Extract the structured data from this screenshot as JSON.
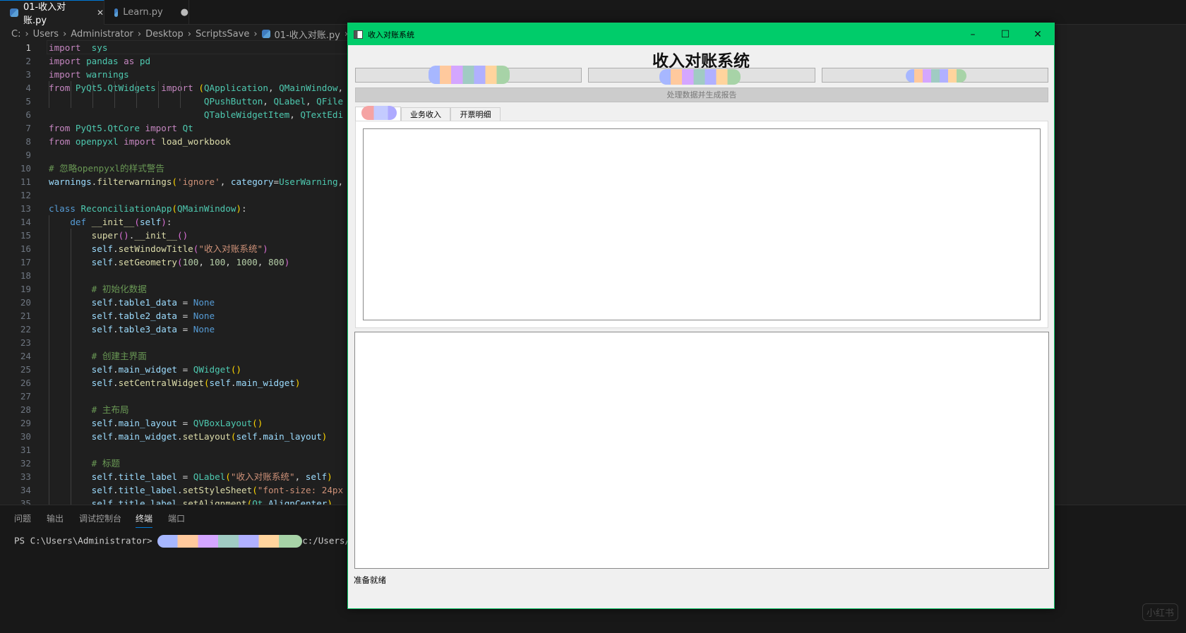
{
  "editor": {
    "tabs": [
      {
        "label": "01-收入对账.py",
        "close": "✕"
      },
      {
        "label": "Learn.py",
        "dirty": "●"
      }
    ],
    "breadcrumb": [
      "C:",
      "Users",
      "Administrator",
      "Desktop",
      "ScriptsSave",
      "01-收入对账.py",
      "..."
    ],
    "current_line": 1,
    "lines": [
      [
        [
          "kw",
          "import"
        ],
        [
          "",
          "  "
        ],
        [
          "mod",
          "sys"
        ]
      ],
      [
        [
          "kw",
          "import"
        ],
        [
          "mod",
          " pandas"
        ],
        [
          "kw",
          " as"
        ],
        [
          "mod",
          " pd"
        ]
      ],
      [
        [
          "kw",
          "import"
        ],
        [
          "mod",
          " warnings"
        ]
      ],
      [
        [
          "kw",
          "from"
        ],
        [
          "mod",
          " PyQt5.QtWidgets"
        ],
        [
          "kw",
          " import"
        ],
        [
          "",
          " "
        ],
        [
          "br",
          "("
        ],
        [
          "mod",
          "QApplication"
        ],
        [
          "",
          ", "
        ],
        [
          "mod",
          "QMainWindow"
        ],
        [
          "",
          ","
        ]
      ],
      [
        [
          "",
          "                             "
        ],
        [
          "mod",
          "QPushButton"
        ],
        [
          "",
          ", "
        ],
        [
          "mod",
          "QLabel"
        ],
        [
          "",
          ", "
        ],
        [
          "mod",
          "QFile"
        ]
      ],
      [
        [
          "",
          "                             "
        ],
        [
          "mod",
          "QTableWidgetItem"
        ],
        [
          "",
          ", "
        ],
        [
          "mod",
          "QTextEdi"
        ]
      ],
      [
        [
          "kw",
          "from"
        ],
        [
          "mod",
          " PyQt5.QtCore"
        ],
        [
          "kw",
          " import"
        ],
        [
          "mod",
          " Qt"
        ]
      ],
      [
        [
          "kw",
          "from"
        ],
        [
          "mod",
          " openpyxl"
        ],
        [
          "kw",
          " import"
        ],
        [
          "fn",
          " load_workbook"
        ]
      ],
      [],
      [
        [
          "cm",
          "# 忽略openpyxl的样式警告"
        ]
      ],
      [
        [
          "var",
          "warnings"
        ],
        [
          "",
          "."
        ],
        [
          "fn",
          "filterwarnings"
        ],
        [
          "br",
          "("
        ],
        [
          "str",
          "'ignore'"
        ],
        [
          "",
          ", "
        ],
        [
          "var",
          "category"
        ],
        [
          "",
          "="
        ],
        [
          "mod",
          "UserWarning"
        ],
        [
          "",
          ","
        ]
      ],
      [],
      [
        [
          "bl",
          "class"
        ],
        [
          "mod",
          " ReconciliationApp"
        ],
        [
          "br",
          "("
        ],
        [
          "mod",
          "QMainWindow"
        ],
        [
          "br",
          ")"
        ],
        [
          "",
          ":"
        ]
      ],
      [
        [
          "",
          "    "
        ],
        [
          "bl",
          "def"
        ],
        [
          "fn",
          " __init__"
        ],
        [
          "br2",
          "("
        ],
        [
          "var",
          "self"
        ],
        [
          "br2",
          ")"
        ],
        [
          "",
          ":"
        ]
      ],
      [
        [
          "",
          "        "
        ],
        [
          "fn",
          "super"
        ],
        [
          "br2",
          "()"
        ],
        [
          "",
          "."
        ],
        [
          "fn",
          "__init__"
        ],
        [
          "br2",
          "()"
        ]
      ],
      [
        [
          "",
          "        "
        ],
        [
          "var",
          "self"
        ],
        [
          "",
          "."
        ],
        [
          "fn",
          "setWindowTitle"
        ],
        [
          "br2",
          "("
        ],
        [
          "str",
          "\"收入对账系统\""
        ],
        [
          "br2",
          ")"
        ]
      ],
      [
        [
          "",
          "        "
        ],
        [
          "var",
          "self"
        ],
        [
          "",
          "."
        ],
        [
          "fn",
          "setGeometry"
        ],
        [
          "br2",
          "("
        ],
        [
          "num",
          "100"
        ],
        [
          "",
          ", "
        ],
        [
          "num",
          "100"
        ],
        [
          "",
          ", "
        ],
        [
          "num",
          "1000"
        ],
        [
          "",
          ", "
        ],
        [
          "num",
          "800"
        ],
        [
          "br2",
          ")"
        ]
      ],
      [],
      [
        [
          "",
          "        "
        ],
        [
          "cm",
          "# 初始化数据"
        ]
      ],
      [
        [
          "",
          "        "
        ],
        [
          "var",
          "self"
        ],
        [
          "",
          "."
        ],
        [
          "var",
          "table1_data"
        ],
        [
          "",
          " = "
        ],
        [
          "bl",
          "None"
        ]
      ],
      [
        [
          "",
          "        "
        ],
        [
          "var",
          "self"
        ],
        [
          "",
          "."
        ],
        [
          "var",
          "table2_data"
        ],
        [
          "",
          " = "
        ],
        [
          "bl",
          "None"
        ]
      ],
      [
        [
          "",
          "        "
        ],
        [
          "var",
          "self"
        ],
        [
          "",
          "."
        ],
        [
          "var",
          "table3_data"
        ],
        [
          "",
          " = "
        ],
        [
          "bl",
          "None"
        ]
      ],
      [],
      [
        [
          "",
          "        "
        ],
        [
          "cm",
          "# 创建主界面"
        ]
      ],
      [
        [
          "",
          "        "
        ],
        [
          "var",
          "self"
        ],
        [
          "",
          "."
        ],
        [
          "var",
          "main_widget"
        ],
        [
          "",
          " = "
        ],
        [
          "mod",
          "QWidget"
        ],
        [
          "br",
          "()"
        ]
      ],
      [
        [
          "",
          "        "
        ],
        [
          "var",
          "self"
        ],
        [
          "",
          "."
        ],
        [
          "fn",
          "setCentralWidget"
        ],
        [
          "br",
          "("
        ],
        [
          "var",
          "self"
        ],
        [
          "",
          "."
        ],
        [
          "var",
          "main_widget"
        ],
        [
          "br",
          ")"
        ]
      ],
      [],
      [
        [
          "",
          "        "
        ],
        [
          "cm",
          "# 主布局"
        ]
      ],
      [
        [
          "",
          "        "
        ],
        [
          "var",
          "self"
        ],
        [
          "",
          "."
        ],
        [
          "var",
          "main_layout"
        ],
        [
          "",
          " = "
        ],
        [
          "mod",
          "QVBoxLayout"
        ],
        [
          "br",
          "()"
        ]
      ],
      [
        [
          "",
          "        "
        ],
        [
          "var",
          "self"
        ],
        [
          "",
          "."
        ],
        [
          "var",
          "main_widget"
        ],
        [
          "",
          "."
        ],
        [
          "fn",
          "setLayout"
        ],
        [
          "br",
          "("
        ],
        [
          "var",
          "self"
        ],
        [
          "",
          "."
        ],
        [
          "var",
          "main_layout"
        ],
        [
          "br",
          ")"
        ]
      ],
      [],
      [
        [
          "",
          "        "
        ],
        [
          "cm",
          "# 标题"
        ]
      ],
      [
        [
          "",
          "        "
        ],
        [
          "var",
          "self"
        ],
        [
          "",
          "."
        ],
        [
          "var",
          "title_label"
        ],
        [
          "",
          " = "
        ],
        [
          "mod",
          "QLabel"
        ],
        [
          "br",
          "("
        ],
        [
          "str",
          "\"收入对账系统\""
        ],
        [
          "",
          ", "
        ],
        [
          "var",
          "self"
        ],
        [
          "br",
          ")"
        ]
      ],
      [
        [
          "",
          "        "
        ],
        [
          "var",
          "self"
        ],
        [
          "",
          "."
        ],
        [
          "var",
          "title_label"
        ],
        [
          "",
          "."
        ],
        [
          "fn",
          "setStyleSheet"
        ],
        [
          "br",
          "("
        ],
        [
          "str",
          "\"font-size: 24px"
        ]
      ],
      [
        [
          "",
          "        "
        ],
        [
          "var",
          "self"
        ],
        [
          "",
          "."
        ],
        [
          "var",
          "title_label"
        ],
        [
          "",
          "."
        ],
        [
          "fn",
          "setAlignment"
        ],
        [
          "br",
          "("
        ],
        [
          "mod",
          "Qt"
        ],
        [
          "",
          "."
        ],
        [
          "var",
          "AlignCenter"
        ],
        [
          "br",
          ")"
        ]
      ]
    ]
  },
  "panel": {
    "tabs": [
      "问题",
      "输出",
      "调试控制台",
      "终端",
      "端口"
    ],
    "active_tab": "终端",
    "terminal_prompt": "PS C:\\Users\\Administrator> ",
    "terminal_tail": "c:/Users/A"
  },
  "app": {
    "window_title": "收入对账系统",
    "controls": {
      "minimize": "–",
      "maximize": "☐",
      "close": "✕"
    },
    "heading": "收入对账系统",
    "process_button": "处理数据并生成报告",
    "tabs": [
      "业务收入",
      "开票明细"
    ],
    "status": "准备就绪",
    "titlebar_color": "#00cc6a"
  },
  "watermark": "小红书"
}
